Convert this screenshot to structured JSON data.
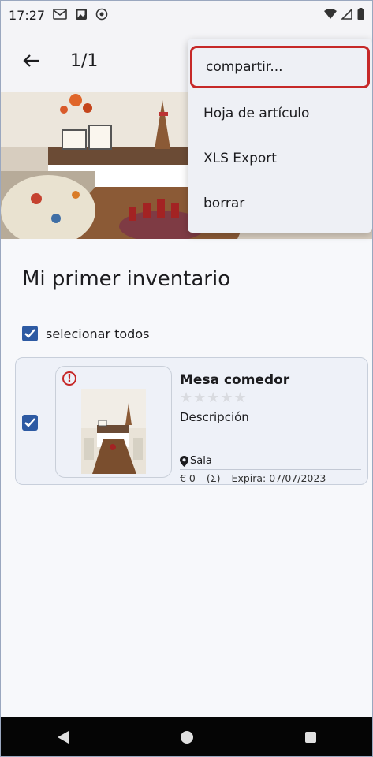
{
  "status_bar": {
    "time": "17:27",
    "icons_left": [
      "gmail-icon",
      "photo-icon",
      "sync-icon"
    ],
    "icons_right": [
      "wifi-icon",
      "signal-icon",
      "battery-icon"
    ]
  },
  "app_bar": {
    "title": "1/1"
  },
  "menu": {
    "items": [
      {
        "label": "compartir..."
      },
      {
        "label": "Hoja de artículo"
      },
      {
        "label": "XLS Export"
      },
      {
        "label": "borrar"
      }
    ]
  },
  "inventory": {
    "title": "Mi primer inventario",
    "select_all_label": "selecionar todos"
  },
  "item": {
    "name": "Mesa comedor",
    "rating": 0,
    "rating_max": 5,
    "stars": "★★★★★",
    "description": "Descripción",
    "location": "Sala",
    "price": "€ 0",
    "sigma": "(Σ)",
    "expiry": "Expira: 07/07/2023"
  },
  "colors": {
    "accent": "#2d5aa3",
    "highlight": "#c62828",
    "background": "#f7f8fb"
  }
}
